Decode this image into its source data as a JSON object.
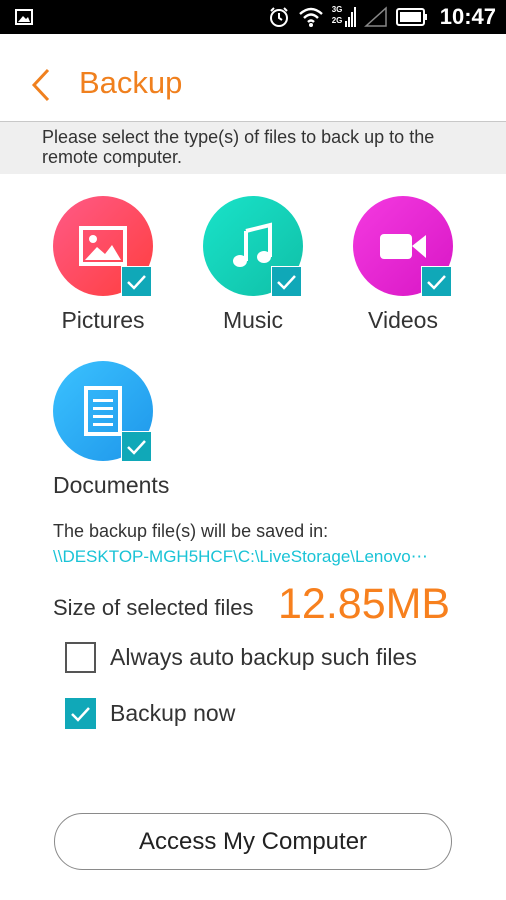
{
  "status_bar": {
    "time": "10:47",
    "network_labels": [
      "3G",
      "2G"
    ],
    "icons": [
      "image-notification-icon",
      "alarm-icon",
      "wifi-icon",
      "signal-icon",
      "no-signal-icon",
      "battery-icon"
    ]
  },
  "header": {
    "title": "Backup",
    "back_icon": "chevron-left-icon"
  },
  "instructions": "Please select the type(s) of files to back up to the remote computer.",
  "file_types": [
    {
      "label": "Pictures",
      "icon": "picture-icon",
      "checked": true,
      "color": "#ff4a6a"
    },
    {
      "label": "Music",
      "icon": "music-note-icon",
      "checked": true,
      "color": "#13d3b8"
    },
    {
      "label": "Videos",
      "icon": "video-camera-icon",
      "checked": true,
      "color": "#e727d6"
    },
    {
      "label": "Documents",
      "icon": "document-icon",
      "checked": true,
      "color": "#28abf5"
    }
  ],
  "save_location": {
    "label": "The backup file(s) will be saved in:",
    "path": "\\\\DESKTOP-MGH5HCF\\C:\\LiveStorage\\Lenovo⋯"
  },
  "size": {
    "label": "Size of selected files",
    "value": "12.85MB"
  },
  "options": [
    {
      "label": "Always auto backup such files",
      "checked": false
    },
    {
      "label": "Backup now",
      "checked": true
    }
  ],
  "access_button": "Access My Computer",
  "colors": {
    "accent_orange": "#f0801e",
    "teal_check": "#10a8b8",
    "path_cyan": "#19c3d6"
  }
}
